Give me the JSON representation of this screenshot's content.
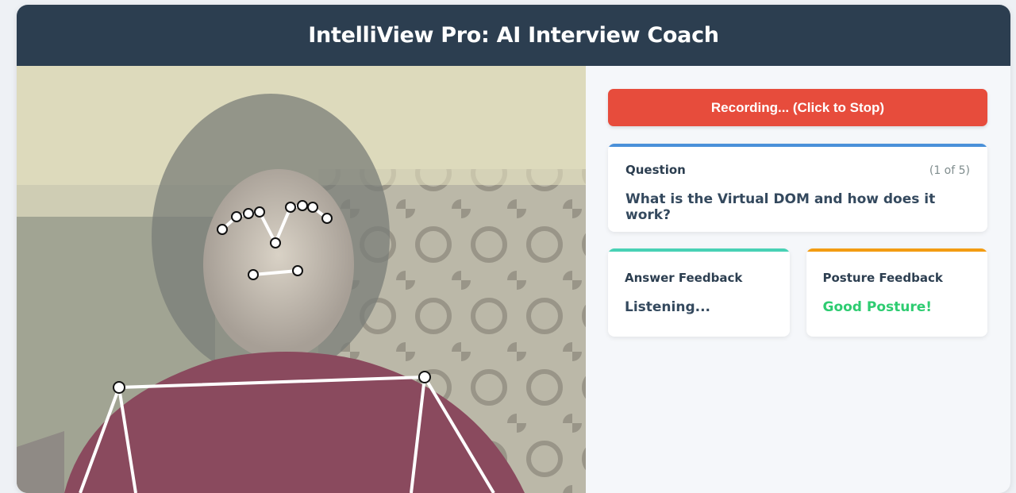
{
  "app": {
    "title": "IntelliView Pro: AI Interview Coach"
  },
  "controls": {
    "record_label": "Recording... (Click to Stop)"
  },
  "question": {
    "heading": "Question",
    "counter": "(1 of 5)",
    "text": "What is the Virtual DOM and how does it work?"
  },
  "answer_feedback": {
    "heading": "Answer Feedback",
    "status": "Listening..."
  },
  "posture_feedback": {
    "heading": "Posture Feedback",
    "status": "Good Posture!"
  },
  "colors": {
    "header": "#2c3e50",
    "record": "#e74c3c",
    "question_accent": "#4a90d9",
    "answer_accent": "#48d1b5",
    "posture_accent": "#f39c12",
    "good": "#2ecc71"
  },
  "icons": {
    "pose_overlay": "pose-keypoints-overlay"
  }
}
